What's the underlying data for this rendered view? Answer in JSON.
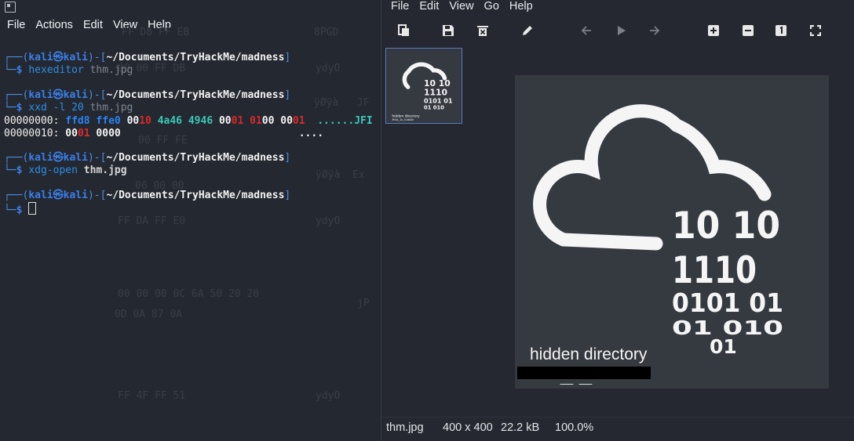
{
  "terminal": {
    "menu": [
      "File",
      "Actions",
      "Edit",
      "View",
      "Help"
    ],
    "prompt_user": "kali",
    "prompt_at": "㉿",
    "prompt_host": "kali",
    "prompt_path": "~/Documents/TryHackMe/madness",
    "commands": [
      {
        "cmd": "hexeditor",
        "arg": "thm.jpg"
      },
      {
        "cmd": "xxd -l 20",
        "arg": "thm.jpg"
      },
      {
        "cmd": "xdg-open",
        "arg": "thm.jpg"
      }
    ],
    "hex_lines": [
      {
        "addr": "00000000:",
        "ascii": "......JFI"
      },
      {
        "addr": "00000010:",
        "ascii": "...."
      }
    ],
    "background_ghost": [
      "FF D8 FF EB",
      "8PGD",
      "00 00 FF DB",
      "ydyO",
      "ÿØÿà   JF",
      "00 FF FE",
      "ÿØÿà  Ex",
      "06 00 00",
      "FF DA FF E0",
      "ydyO",
      "00 00 00 0C 6A 50 20 20",
      "jP",
      "0D 0A 87 0A",
      "FF 4F FF 51",
      "ydyO"
    ]
  },
  "viewer": {
    "menu": [
      "File",
      "Edit",
      "View",
      "Go",
      "Help"
    ],
    "toolbar": [
      "open-icon",
      "save-icon",
      "delete-icon",
      "edit-icon",
      "prev-icon",
      "play-icon",
      "next-icon",
      "zoom-in-icon",
      "zoom-out-icon",
      "zoom-1to1-icon",
      "fullscreen-icon"
    ],
    "thumbnail_caption": "hidden directory",
    "image": {
      "binary_rows": [
        "10 10",
        "1110",
        "0101 01",
        "01 010",
        "01"
      ],
      "caption": "hidden directory",
      "redacted_hint": "_ _"
    },
    "status": {
      "filename": "thm.jpg",
      "dimensions": "400 x 400",
      "size": "22.2 kB",
      "zoom": "100.0%"
    }
  }
}
